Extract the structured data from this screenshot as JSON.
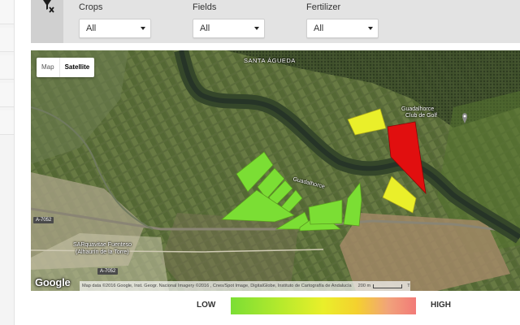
{
  "filters": {
    "crops": {
      "label": "Crops",
      "value": "All"
    },
    "fields": {
      "label": "Fields",
      "value": "All"
    },
    "fertilizer": {
      "label": "Fertilizer",
      "value": "All"
    }
  },
  "map": {
    "type_buttons": {
      "map": "Map",
      "satellite": "Satellite",
      "selected": "Satellite"
    },
    "labels": {
      "santa_agueda": "SANTA ÁGUEDA",
      "guadalhorce_club_1": "Guadalhorce",
      "guadalhorce_club_2": "Club de Golf",
      "guadalhorce_river": "Guadalhorce",
      "sarquavitae_1": "SARquavitae Fuenteso",
      "sarquavitae_2": "(Alhaurín de la Torre)"
    },
    "road_tags": {
      "a7052_top": "A-7052",
      "a7052_bottom": "A-7052"
    },
    "google_logo": "Google",
    "attribution": "Map data ©2016 Google, Inst. Geogr. Nacional Imagery ©2016 , Cnes/Spot Image, DigitalGlobe, Instituto de Cartografía de Andalucía",
    "scale": "200 m",
    "terms": "T",
    "field_colors": {
      "low": "#7bde34",
      "mid": "#eaef2a",
      "high": "#e10f0f"
    }
  },
  "legend": {
    "low_label": "LOW",
    "high_label": "HIGH",
    "gradient": [
      "#7bde34",
      "#b8ea2c",
      "#eaef2a",
      "#f4d12e",
      "#f1a37a",
      "#f27a78"
    ]
  }
}
